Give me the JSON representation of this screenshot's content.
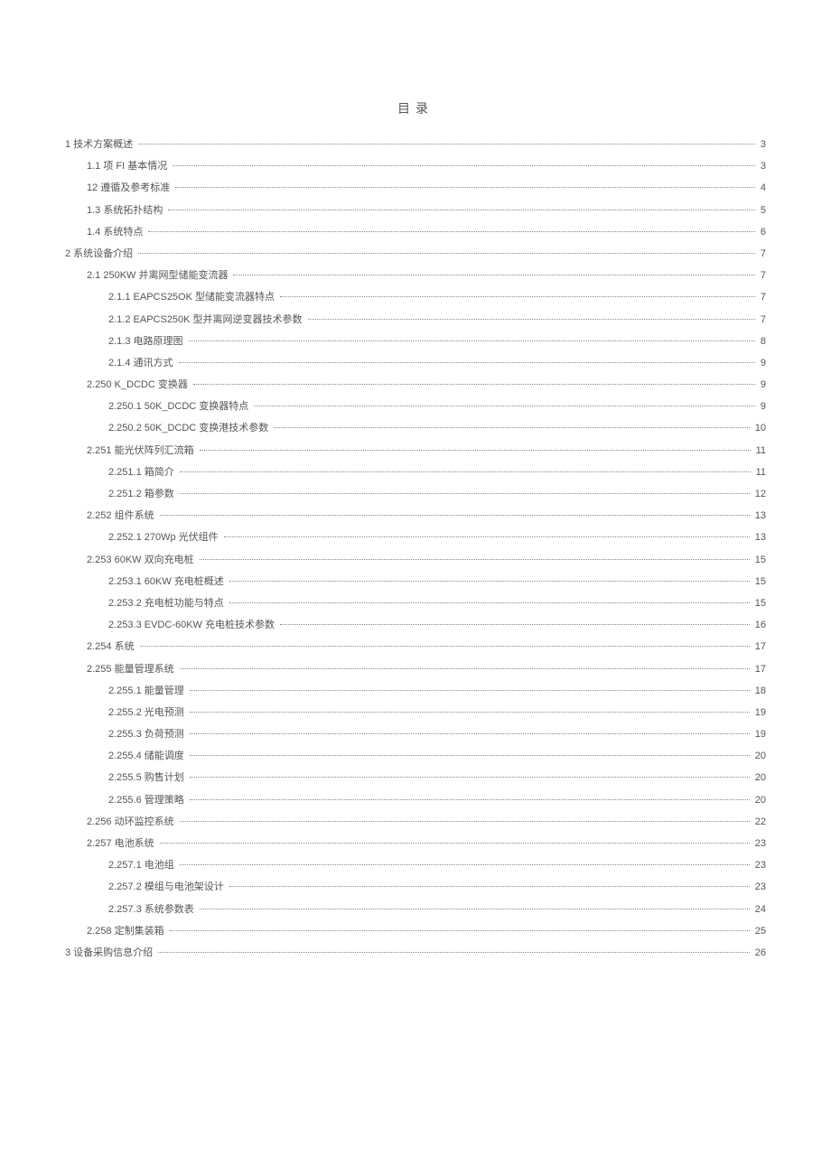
{
  "title": "目录",
  "toc": [
    {
      "level": 0,
      "text": "1 技术方案概述",
      "page": "3"
    },
    {
      "level": 1,
      "text": "1.1    项 FI 基本情况",
      "page": "3"
    },
    {
      "level": 1,
      "text": "12 遵循及参考标准",
      "page": "4"
    },
    {
      "level": 1,
      "text": "1.3     系统拓扑结构",
      "page": "5"
    },
    {
      "level": 1,
      "text": "1.4     系统特点",
      "page": "6"
    },
    {
      "level": 0,
      "text": "2 系统设备介绍",
      "page": "7"
    },
    {
      "level": 1,
      "text": "2.1     250KW 并离网型储能变流器",
      "page": "7"
    },
    {
      "level": 2,
      "text": "2.1.1     EAPCS25OK 型储能变流器特点",
      "page": "7"
    },
    {
      "level": 2,
      "text": "2.1.2     EAPCS250K 型并离网逆变器技术参数",
      "page": "7"
    },
    {
      "level": 2,
      "text": "2.1.3     电路原理图",
      "page": "8"
    },
    {
      "level": 2,
      "text": "2.1.4     通讯方式",
      "page": "9"
    },
    {
      "level": 1,
      "text": "2.250    K_DCDC 变换器",
      "page": "9"
    },
    {
      "level": 2,
      "text": "2.250.1 50K_DCDC 变换器特点",
      "page": "9"
    },
    {
      "level": 2,
      "text": "2.250.2 50K_DCDC 变换港技术参数",
      "page": "10"
    },
    {
      "level": 1,
      "text": "2.251           能光伏阵列汇流箱",
      "page": "11"
    },
    {
      "level": 2,
      "text": "2.251.1           箱简介",
      "page": "11"
    },
    {
      "level": 2,
      "text": "2.251.2           箱参数",
      "page": "12"
    },
    {
      "level": 1,
      "text": "2.252           组件系统",
      "page": "13"
    },
    {
      "level": 2,
      "text": "2.252.1 270Wp 光伏组件",
      "page": "13"
    },
    {
      "level": 1,
      "text": "2.253 60KW 双向充电桩",
      "page": "15"
    },
    {
      "level": 2,
      "text": "2.253.1 60KW 充电桩概述",
      "page": "15"
    },
    {
      "level": 2,
      "text": "2.253.2 充电桩功能与特点",
      "page": "15"
    },
    {
      "level": 2,
      "text": "2.253.3 EVDC-60KW 充电桩技术参数",
      "page": "16"
    },
    {
      "level": 1,
      "text": "2.254           系统",
      "page": "17"
    },
    {
      "level": 1,
      "text": "2.255         能量管理系统",
      "page": "17"
    },
    {
      "level": 2,
      "text": "2.255.1 能量管理",
      "page": "18"
    },
    {
      "level": 2,
      "text": "2.255.2 光电预测",
      "page": "19"
    },
    {
      "level": 2,
      "text": "2.255.3 负荷预测",
      "page": "19"
    },
    {
      "level": 2,
      "text": "2.255.4 储能调度",
      "page": "20"
    },
    {
      "level": 2,
      "text": "2.255.5 购售计划",
      "page": "20"
    },
    {
      "level": 2,
      "text": "2.255.6 管理策略",
      "page": "20"
    },
    {
      "level": 1,
      "text": "2.256 动环监控系统",
      "page": "22"
    },
    {
      "level": 1,
      "text": "2.257 电池系统",
      "page": "23"
    },
    {
      "level": 2,
      "text": "2.257.1 电池组",
      "page": "23"
    },
    {
      "level": 2,
      "text": "2.257.2           模组与电池架设计",
      "page": "23"
    },
    {
      "level": 2,
      "text": "2.257.3           系统参数表",
      "page": "24"
    },
    {
      "level": 1,
      "text": "2.258   定制集装箱",
      "page": "25"
    },
    {
      "level": 0,
      "text": "3 设备采购信息介绍",
      "page": "26"
    }
  ]
}
